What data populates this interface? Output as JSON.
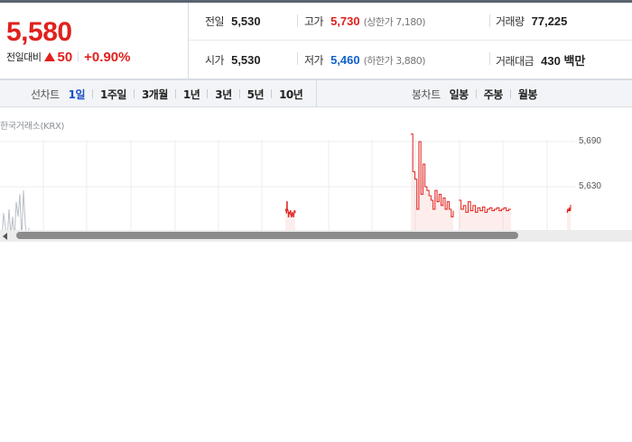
{
  "summary": {
    "price": "5,580",
    "change_label": "전일대비",
    "change_value": "50",
    "change_pct": "+0.90%",
    "prev_close": {
      "label": "전일",
      "value": "5,530"
    },
    "open": {
      "label": "시가",
      "value": "5,530"
    },
    "high": {
      "label": "고가",
      "value": "5,730",
      "limit": "(상한가 7,180)"
    },
    "low": {
      "label": "저가",
      "value": "5,460",
      "limit": "(하한가 3,880)"
    },
    "volume": {
      "label": "거래량",
      "value": "77,225"
    },
    "amount": {
      "label": "거래대금",
      "value": "430 백만"
    }
  },
  "period_tabs": {
    "label": "선차트",
    "items": [
      "1일",
      "1주일",
      "3개월",
      "1년",
      "3년",
      "5년",
      "10년"
    ],
    "active": "1일"
  },
  "candle_tabs": {
    "label": "봉차트",
    "items": [
      "일봉",
      "주봉",
      "월봉"
    ]
  },
  "chart_data": {
    "type": "line",
    "source": "한국거래소(KRX)",
    "y_ticks": [
      "5,690",
      "5,630"
    ],
    "ylim": [
      5540,
      5720
    ],
    "grid": true,
    "colors": {
      "up": "#e0211d",
      "prev": "#b9bec6"
    },
    "series": [
      {
        "values_prev": [
          5560,
          5595,
          5575,
          5560,
          5600,
          5565,
          5590,
          5560,
          5610,
          5590,
          5620,
          5560,
          5625,
          5580,
          5560,
          5575
        ],
        "values": [
          5600,
          5598,
          5595,
          5610,
          5600,
          5598,
          5590,
          5596,
          5594,
          5596,
          5598,
          5592,
          5590,
          5594,
          5596,
          5592,
          5590,
          5594,
          5598,
          5596,
          5598,
          5700,
          5650,
          5640,
          5600,
          5690,
          5620,
          5660,
          5630,
          5625,
          5618,
          5612,
          5600,
          5625,
          5610,
          5620,
          5605,
          5615,
          5600,
          5610,
          5600,
          5590,
          5598,
          5612,
          5600,
          5605,
          5596,
          5610,
          5598,
          5605,
          5596,
          5602,
          5598,
          5603,
          5596,
          5600,
          5602,
          5598,
          5600,
          5602,
          5598,
          5600,
          5602,
          5598,
          5600,
          5600,
          5598,
          5596,
          5600,
          5598,
          5600,
          5598,
          5600,
          5600,
          5602,
          5598,
          5600,
          5598,
          5600,
          5606
        ]
      }
    ]
  }
}
